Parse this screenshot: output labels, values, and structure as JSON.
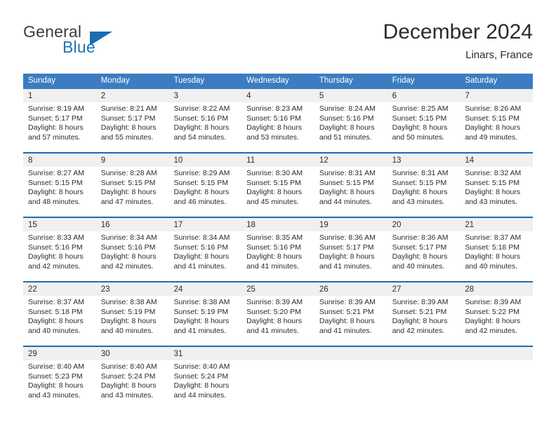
{
  "brand": {
    "name_part1": "General",
    "name_part2": "Blue",
    "logo_icon": "blue-triangle-icon"
  },
  "header": {
    "title": "December 2024",
    "location": "Linars, France"
  },
  "calendar": {
    "weekdays": [
      "Sunday",
      "Monday",
      "Tuesday",
      "Wednesday",
      "Thursday",
      "Friday",
      "Saturday"
    ],
    "colors": {
      "header_background": "#3b7dc0",
      "row_border": "#1f6cb0",
      "day_band_background": "#f0f0f0",
      "text": "#2b2b2b",
      "brand_blue": "#1b75bb"
    },
    "weeks": [
      {
        "days": [
          {
            "date": "1",
            "sunrise": "Sunrise: 8:19 AM",
            "sunset": "Sunset: 5:17 PM",
            "daylight1": "Daylight: 8 hours",
            "daylight2": "and 57 minutes."
          },
          {
            "date": "2",
            "sunrise": "Sunrise: 8:21 AM",
            "sunset": "Sunset: 5:17 PM",
            "daylight1": "Daylight: 8 hours",
            "daylight2": "and 55 minutes."
          },
          {
            "date": "3",
            "sunrise": "Sunrise: 8:22 AM",
            "sunset": "Sunset: 5:16 PM",
            "daylight1": "Daylight: 8 hours",
            "daylight2": "and 54 minutes."
          },
          {
            "date": "4",
            "sunrise": "Sunrise: 8:23 AM",
            "sunset": "Sunset: 5:16 PM",
            "daylight1": "Daylight: 8 hours",
            "daylight2": "and 53 minutes."
          },
          {
            "date": "5",
            "sunrise": "Sunrise: 8:24 AM",
            "sunset": "Sunset: 5:16 PM",
            "daylight1": "Daylight: 8 hours",
            "daylight2": "and 51 minutes."
          },
          {
            "date": "6",
            "sunrise": "Sunrise: 8:25 AM",
            "sunset": "Sunset: 5:15 PM",
            "daylight1": "Daylight: 8 hours",
            "daylight2": "and 50 minutes."
          },
          {
            "date": "7",
            "sunrise": "Sunrise: 8:26 AM",
            "sunset": "Sunset: 5:15 PM",
            "daylight1": "Daylight: 8 hours",
            "daylight2": "and 49 minutes."
          }
        ]
      },
      {
        "days": [
          {
            "date": "8",
            "sunrise": "Sunrise: 8:27 AM",
            "sunset": "Sunset: 5:15 PM",
            "daylight1": "Daylight: 8 hours",
            "daylight2": "and 48 minutes."
          },
          {
            "date": "9",
            "sunrise": "Sunrise: 8:28 AM",
            "sunset": "Sunset: 5:15 PM",
            "daylight1": "Daylight: 8 hours",
            "daylight2": "and 47 minutes."
          },
          {
            "date": "10",
            "sunrise": "Sunrise: 8:29 AM",
            "sunset": "Sunset: 5:15 PM",
            "daylight1": "Daylight: 8 hours",
            "daylight2": "and 46 minutes."
          },
          {
            "date": "11",
            "sunrise": "Sunrise: 8:30 AM",
            "sunset": "Sunset: 5:15 PM",
            "daylight1": "Daylight: 8 hours",
            "daylight2": "and 45 minutes."
          },
          {
            "date": "12",
            "sunrise": "Sunrise: 8:31 AM",
            "sunset": "Sunset: 5:15 PM",
            "daylight1": "Daylight: 8 hours",
            "daylight2": "and 44 minutes."
          },
          {
            "date": "13",
            "sunrise": "Sunrise: 8:31 AM",
            "sunset": "Sunset: 5:15 PM",
            "daylight1": "Daylight: 8 hours",
            "daylight2": "and 43 minutes."
          },
          {
            "date": "14",
            "sunrise": "Sunrise: 8:32 AM",
            "sunset": "Sunset: 5:15 PM",
            "daylight1": "Daylight: 8 hours",
            "daylight2": "and 43 minutes."
          }
        ]
      },
      {
        "days": [
          {
            "date": "15",
            "sunrise": "Sunrise: 8:33 AM",
            "sunset": "Sunset: 5:16 PM",
            "daylight1": "Daylight: 8 hours",
            "daylight2": "and 42 minutes."
          },
          {
            "date": "16",
            "sunrise": "Sunrise: 8:34 AM",
            "sunset": "Sunset: 5:16 PM",
            "daylight1": "Daylight: 8 hours",
            "daylight2": "and 42 minutes."
          },
          {
            "date": "17",
            "sunrise": "Sunrise: 8:34 AM",
            "sunset": "Sunset: 5:16 PM",
            "daylight1": "Daylight: 8 hours",
            "daylight2": "and 41 minutes."
          },
          {
            "date": "18",
            "sunrise": "Sunrise: 8:35 AM",
            "sunset": "Sunset: 5:16 PM",
            "daylight1": "Daylight: 8 hours",
            "daylight2": "and 41 minutes."
          },
          {
            "date": "19",
            "sunrise": "Sunrise: 8:36 AM",
            "sunset": "Sunset: 5:17 PM",
            "daylight1": "Daylight: 8 hours",
            "daylight2": "and 41 minutes."
          },
          {
            "date": "20",
            "sunrise": "Sunrise: 8:36 AM",
            "sunset": "Sunset: 5:17 PM",
            "daylight1": "Daylight: 8 hours",
            "daylight2": "and 40 minutes."
          },
          {
            "date": "21",
            "sunrise": "Sunrise: 8:37 AM",
            "sunset": "Sunset: 5:18 PM",
            "daylight1": "Daylight: 8 hours",
            "daylight2": "and 40 minutes."
          }
        ]
      },
      {
        "days": [
          {
            "date": "22",
            "sunrise": "Sunrise: 8:37 AM",
            "sunset": "Sunset: 5:18 PM",
            "daylight1": "Daylight: 8 hours",
            "daylight2": "and 40 minutes."
          },
          {
            "date": "23",
            "sunrise": "Sunrise: 8:38 AM",
            "sunset": "Sunset: 5:19 PM",
            "daylight1": "Daylight: 8 hours",
            "daylight2": "and 40 minutes."
          },
          {
            "date": "24",
            "sunrise": "Sunrise: 8:38 AM",
            "sunset": "Sunset: 5:19 PM",
            "daylight1": "Daylight: 8 hours",
            "daylight2": "and 41 minutes."
          },
          {
            "date": "25",
            "sunrise": "Sunrise: 8:39 AM",
            "sunset": "Sunset: 5:20 PM",
            "daylight1": "Daylight: 8 hours",
            "daylight2": "and 41 minutes."
          },
          {
            "date": "26",
            "sunrise": "Sunrise: 8:39 AM",
            "sunset": "Sunset: 5:21 PM",
            "daylight1": "Daylight: 8 hours",
            "daylight2": "and 41 minutes."
          },
          {
            "date": "27",
            "sunrise": "Sunrise: 8:39 AM",
            "sunset": "Sunset: 5:21 PM",
            "daylight1": "Daylight: 8 hours",
            "daylight2": "and 42 minutes."
          },
          {
            "date": "28",
            "sunrise": "Sunrise: 8:39 AM",
            "sunset": "Sunset: 5:22 PM",
            "daylight1": "Daylight: 8 hours",
            "daylight2": "and 42 minutes."
          }
        ]
      },
      {
        "days": [
          {
            "date": "29",
            "sunrise": "Sunrise: 8:40 AM",
            "sunset": "Sunset: 5:23 PM",
            "daylight1": "Daylight: 8 hours",
            "daylight2": "and 43 minutes."
          },
          {
            "date": "30",
            "sunrise": "Sunrise: 8:40 AM",
            "sunset": "Sunset: 5:24 PM",
            "daylight1": "Daylight: 8 hours",
            "daylight2": "and 43 minutes."
          },
          {
            "date": "31",
            "sunrise": "Sunrise: 8:40 AM",
            "sunset": "Sunset: 5:24 PM",
            "daylight1": "Daylight: 8 hours",
            "daylight2": "and 44 minutes."
          },
          {
            "date": "",
            "sunrise": "",
            "sunset": "",
            "daylight1": "",
            "daylight2": ""
          },
          {
            "date": "",
            "sunrise": "",
            "sunset": "",
            "daylight1": "",
            "daylight2": ""
          },
          {
            "date": "",
            "sunrise": "",
            "sunset": "",
            "daylight1": "",
            "daylight2": ""
          },
          {
            "date": "",
            "sunrise": "",
            "sunset": "",
            "daylight1": "",
            "daylight2": ""
          }
        ]
      }
    ]
  }
}
